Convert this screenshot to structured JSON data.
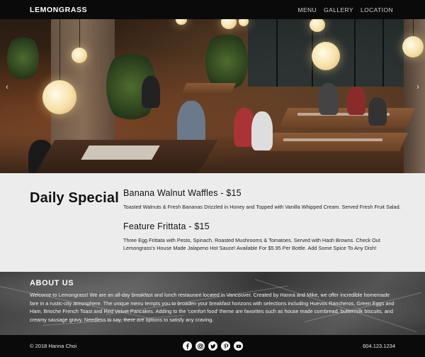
{
  "nav": {
    "logo": "LEMONGRASS",
    "items": [
      {
        "label": "MENU"
      },
      {
        "label": "GALLERY"
      },
      {
        "label": "LOCATION"
      }
    ]
  },
  "hero": {
    "arrow_prev": "‹",
    "arrow_next": "›",
    "slides_count": 3,
    "active_slide": 1
  },
  "special": {
    "title": "Daily Special",
    "items": [
      {
        "name": "Banana Walnut Waffles - $15",
        "description": "Toasted Walnuts & Fresh Bananas Drizzled in Honey and Topped with Vanilla Whipped Cream. Served Fresh Fruit Salad."
      },
      {
        "name": "Feature Frittata - $15",
        "description": "Three Egg Frittata with Pesto, Spinach, Roasted Mushrooms & Tomatoes.  Served with Hash Browns. Check Out Lemongrass's House Made Jalapeno Hot Sauce!  Available For $5.95 Per Bottle. Add Some Spice To Any Dish!"
      }
    ]
  },
  "about": {
    "title": "ABOUT US",
    "text": "Welcome to Lemongrass! We are an all-day breakfast and lunch restaurant located in Vancouver. Created by Hanna and Mike, we offer incredible homemade fare in a rustic-city atmosphere. The unique menu tempts you to broaden your breakfast horizons with selections including Huevos Rancheros, Green Eggs and Ham, Brioche French Toast and Red Velvet Pancakes. Adding to the 'comfort food' theme are favorites such as house made cornbread, buttermilk biscuits, and creamy sausage gravy. Needless to say, there are options to satisfy any craving."
  },
  "footer": {
    "copyright": "© 2018 Hanna Choi",
    "phone": "604.123.1234",
    "socials": [
      {
        "icon": "facebook-icon"
      },
      {
        "icon": "instagram-icon"
      },
      {
        "icon": "twitter-icon"
      },
      {
        "icon": "pinterest-icon"
      },
      {
        "icon": "youtube-icon"
      }
    ]
  },
  "colors": {
    "nav_bg": "#0a0a0a",
    "special_bg": "#ececec",
    "footer_bg": "#0a0a0a",
    "text_light": "#ffffff"
  }
}
